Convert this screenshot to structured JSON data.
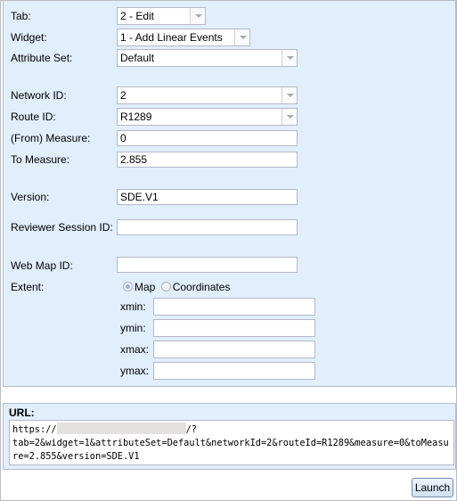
{
  "form": {
    "tab": {
      "label": "Tab:",
      "value": "2 - Edit"
    },
    "widget": {
      "label": "Widget:",
      "value": "1 - Add Linear Events"
    },
    "attribute_set": {
      "label": "Attribute Set:",
      "value": "Default"
    },
    "network_id": {
      "label": "Network ID:",
      "value": "2"
    },
    "route_id": {
      "label": "Route ID:",
      "value": "R1289"
    },
    "from_measure": {
      "label": "(From) Measure:",
      "value": "0"
    },
    "to_measure": {
      "label": "To Measure:",
      "value": "2.855"
    },
    "version": {
      "label": "Version:",
      "value": "SDE.V1"
    },
    "reviewer_session_id": {
      "label": "Reviewer Session ID:",
      "value": ""
    },
    "web_map_id": {
      "label": "Web Map ID:",
      "value": ""
    },
    "extent": {
      "label": "Extent:",
      "options": [
        {
          "label": "Map",
          "selected": true
        },
        {
          "label": "Coordinates",
          "selected": false
        }
      ],
      "xmin": {
        "label": "xmin:",
        "value": ""
      },
      "ymin": {
        "label": "ymin:",
        "value": ""
      },
      "xmax": {
        "label": "xmax:",
        "value": ""
      },
      "ymax": {
        "label": "ymax:",
        "value": ""
      }
    }
  },
  "url": {
    "label": "URL:",
    "prefix": "https://",
    "after_redaction": "/?",
    "query": "tab=2&widget=1&attributeSet=Default&networkId=2&routeId=R1289&measure=0&toMeasure=2.855&version=SDE.V1"
  },
  "actions": {
    "launch_label": "Launch"
  }
}
